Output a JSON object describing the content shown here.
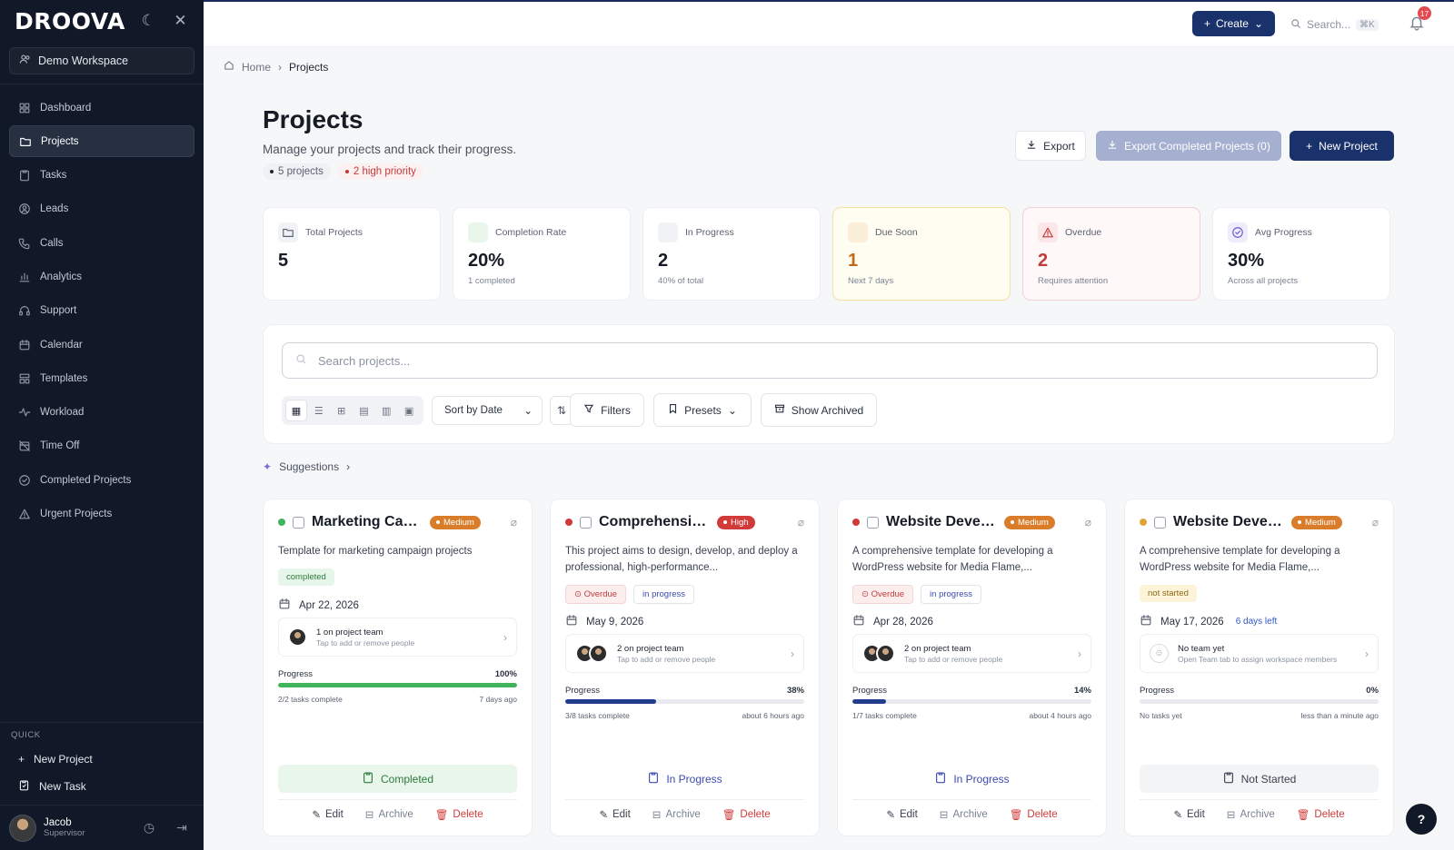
{
  "brand": {
    "logo": "DROOVA",
    "theme_icon": "moon-icon",
    "close_icon": "close-icon"
  },
  "workspace": {
    "name": "Demo Workspace"
  },
  "sidebar": {
    "items": [
      {
        "label": "Dashboard",
        "icon": "dashboard-icon"
      },
      {
        "label": "Projects",
        "icon": "folder-icon",
        "active": true
      },
      {
        "label": "Tasks",
        "icon": "clipboard-icon"
      },
      {
        "label": "Leads",
        "icon": "user-circle-icon"
      },
      {
        "label": "Calls",
        "icon": "phone-icon"
      },
      {
        "label": "Analytics",
        "icon": "bar-chart-icon"
      },
      {
        "label": "Support",
        "icon": "headset-icon"
      },
      {
        "label": "Calendar",
        "icon": "calendar-icon"
      },
      {
        "label": "Templates",
        "icon": "template-icon"
      },
      {
        "label": "Workload",
        "icon": "activity-icon"
      },
      {
        "label": "Time Off",
        "icon": "calendar-off-icon"
      },
      {
        "label": "Completed Projects",
        "icon": "check-circle-icon"
      },
      {
        "label": "Urgent Projects",
        "icon": "warning-icon"
      }
    ],
    "quick_title": "QUICK",
    "quick": [
      {
        "label": "New Project",
        "icon": "plus-icon"
      },
      {
        "label": "New Task",
        "icon": "clipboard-icon"
      }
    ],
    "user": {
      "name": "Jacob",
      "role": "Supervisor"
    }
  },
  "topbar": {
    "create_label": "Create",
    "search_placeholder": "Search...",
    "search_shortcut": "⌘K",
    "notification_count": "17"
  },
  "breadcrumb": {
    "home": "Home",
    "current": "Projects"
  },
  "header": {
    "title": "Projects",
    "subtitle": "Manage your projects and track their progress.",
    "project_count": "5 projects",
    "high_priority": "2 high priority",
    "export_label": "Export",
    "export_completed_label": "Export Completed Projects (0)",
    "new_project_label": "New Project"
  },
  "stats": [
    {
      "label": "Total Projects",
      "value": "5",
      "note": "",
      "icon": "folder-icon"
    },
    {
      "label": "Completion Rate",
      "value": "20%",
      "note": "1 completed",
      "icon": "trend-up-icon"
    },
    {
      "label": "In Progress",
      "value": "2",
      "note": "40% of total",
      "icon": "clock-icon"
    },
    {
      "label": "Due Soon",
      "value": "1",
      "note": "Next 7 days",
      "icon": "clock-icon"
    },
    {
      "label": "Overdue",
      "value": "2",
      "note": "Requires attention",
      "icon": "warning-icon"
    },
    {
      "label": "Avg Progress",
      "value": "30%",
      "note": "Across all projects",
      "icon": "check-circle-icon"
    }
  ],
  "filters": {
    "search_placeholder": "Search projects...",
    "sort_label": "Sort by Date",
    "filters_label": "Filters",
    "presets_label": "Presets",
    "archived_label": "Show Archived"
  },
  "suggestions_label": "Suggestions",
  "colors": {
    "primary": "#1a326b",
    "green": "#3fb45a",
    "blue": "#1f3d8a",
    "red": "#d23a3a",
    "orange": "#d97d2b"
  },
  "cards": [
    {
      "title": "Marketing Cam...",
      "priority": "Medium",
      "status_dot": "#3fb45a",
      "description": "Template for marketing campaign projects",
      "tags": [
        "completed"
      ],
      "date": "Apr 22, 2026",
      "date_extra": "",
      "team_title": "1 on project team",
      "team_hint": "Tap to add or remove people",
      "progress_label": "Progress",
      "progress": "100%",
      "progress_value": 100,
      "progress_color": "#3fb45a",
      "tasks": "2/2 tasks complete",
      "updated": "7 days ago",
      "status": "Completed",
      "edit": "Edit",
      "archive": "Archive",
      "delete": "Delete"
    },
    {
      "title": "Comprehensive D...",
      "priority": "High",
      "status_dot": "#d23a3a",
      "description": "This project aims to design, develop, and deploy a professional, high-performance...",
      "tags": [
        "Overdue",
        "in progress"
      ],
      "date": "May 9, 2026",
      "date_extra": "",
      "team_title": "2 on project team",
      "team_hint": "Tap to add or remove people",
      "progress_label": "Progress",
      "progress": "38%",
      "progress_value": 38,
      "progress_color": "#1f3d8a",
      "tasks": "3/8 tasks complete",
      "updated": "about 6 hours ago",
      "status": "In Progress",
      "edit": "Edit",
      "archive": "Archive",
      "delete": "Delete"
    },
    {
      "title": "Website Develo...",
      "priority": "Medium",
      "status_dot": "#d23a3a",
      "description": "A comprehensive template for developing a WordPress website for Media Flame,...",
      "tags": [
        "Overdue",
        "in progress"
      ],
      "date": "Apr 28, 2026",
      "date_extra": "",
      "team_title": "2 on project team",
      "team_hint": "Tap to add or remove people",
      "progress_label": "Progress",
      "progress": "14%",
      "progress_value": 14,
      "progress_color": "#1f3d8a",
      "tasks": "1/7 tasks complete",
      "updated": "about 4 hours ago",
      "status": "In Progress",
      "edit": "Edit",
      "archive": "Archive",
      "delete": "Delete"
    },
    {
      "title": "Website Develo...",
      "priority": "Medium",
      "status_dot": "#e0a53a",
      "description": "A comprehensive template for developing a WordPress website for Media Flame,...",
      "tags": [
        "not started"
      ],
      "date": "May 17, 2026",
      "date_extra": "6 days left",
      "team_title": "No team yet",
      "team_hint": "Open Team tab to assign workspace members",
      "progress_label": "Progress",
      "progress": "0%",
      "progress_value": 0,
      "progress_color": "#1f3d8a",
      "tasks": "No tasks yet",
      "updated": "less than a minute ago",
      "status": "Not Started",
      "edit": "Edit",
      "archive": "Archive",
      "delete": "Delete"
    }
  ]
}
